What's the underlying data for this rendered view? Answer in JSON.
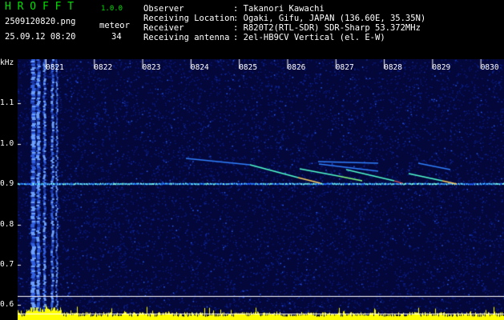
{
  "app": {
    "name": "H R O F F T",
    "version": "1.0.0"
  },
  "file": {
    "name": "2509120820.png",
    "datetime": "25.09.12 08:20"
  },
  "meteor": {
    "label": "meteor",
    "count": "34"
  },
  "info": [
    {
      "label": "Observer",
      "value": ": Takanori Kawachi"
    },
    {
      "label": "Receiving Location",
      "value": ": Ogaki, Gifu, JAPAN (136.60E, 35.35N)"
    },
    {
      "label": "Receiver",
      "value": ": R820T2(RTL-SDR) SDR-Sharp 53.372MHz"
    },
    {
      "label": "Receiving antenna",
      "value": ": 2el-HB9CV Vertical (el. E-W)"
    }
  ],
  "axis": {
    "unit": "kHz",
    "y_ticks": [
      "1.1",
      "1.0",
      "0.9",
      "0.8",
      "0.7",
      "0.6"
    ],
    "x_ticks": [
      "0821",
      "0822",
      "0823",
      "0824",
      "0825",
      "0826",
      "0827",
      "0828",
      "0829",
      "0830"
    ]
  },
  "colors": {
    "title": "#00e000",
    "background": "#05093a",
    "histogram": "#ffff00",
    "echo": "#40ffd0"
  }
}
